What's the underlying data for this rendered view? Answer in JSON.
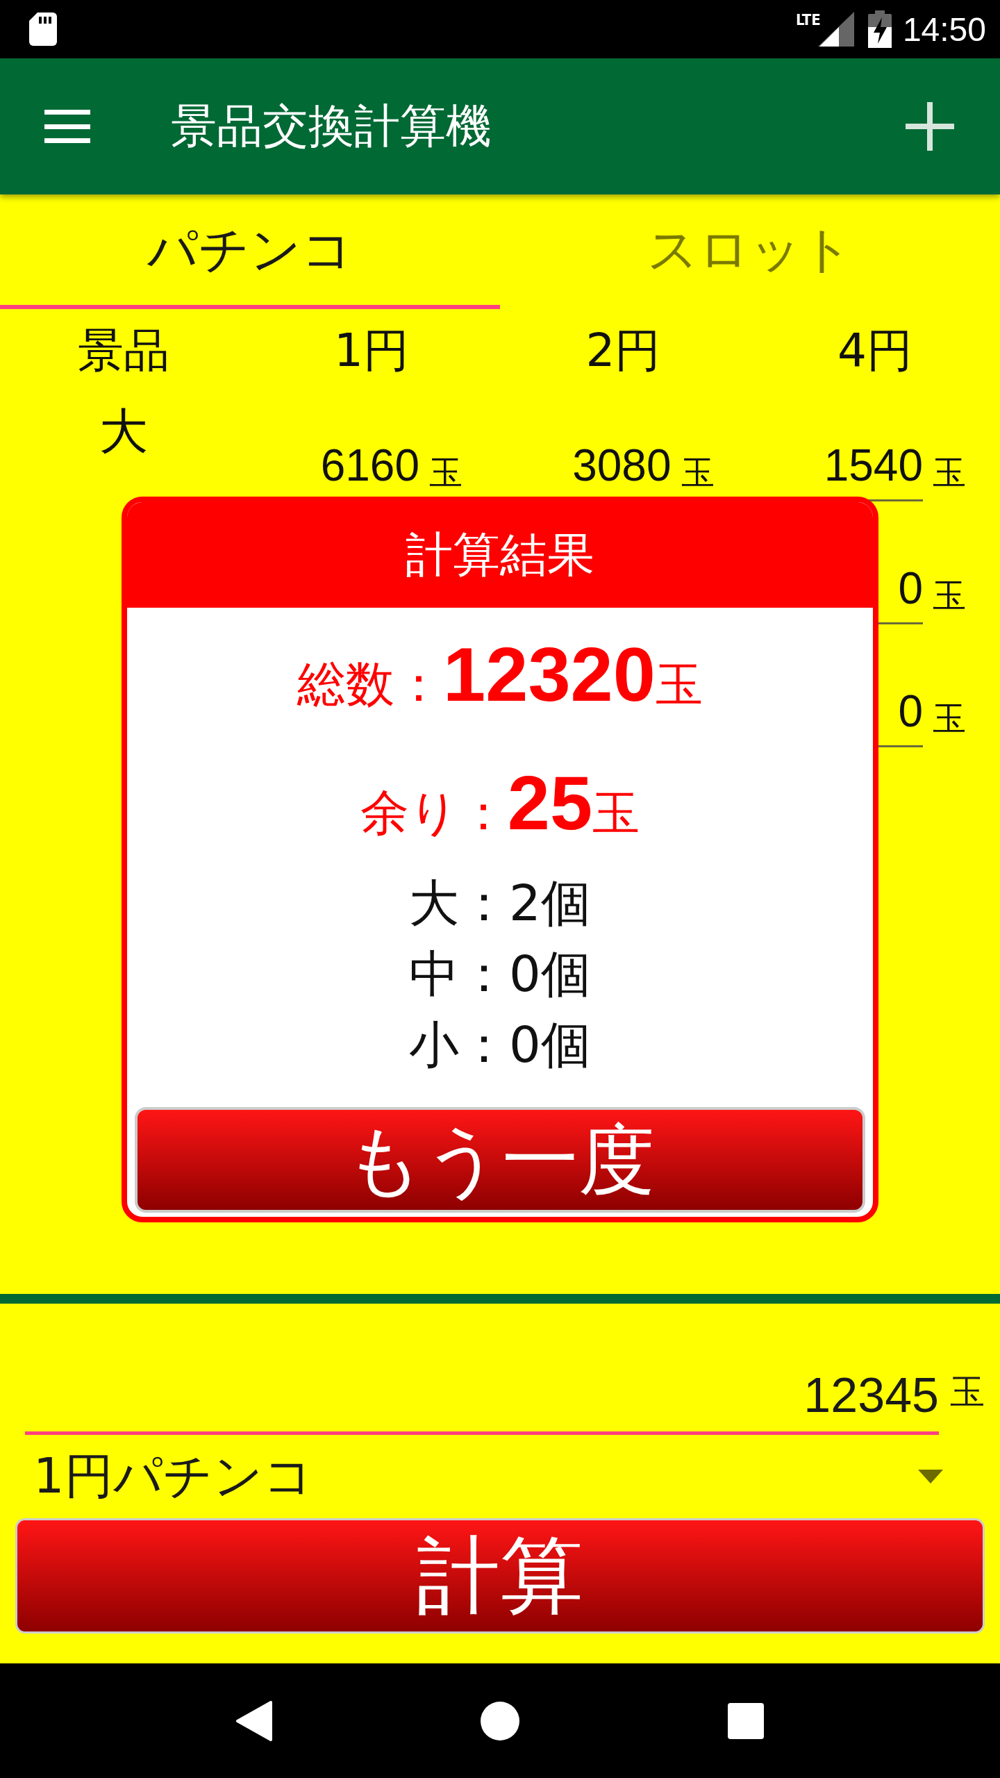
{
  "status_bar": {
    "network": "LTE",
    "time": "14:50"
  },
  "app_bar": {
    "title": "景品交換計算機"
  },
  "tabs": [
    {
      "label": "パチンコ",
      "selected": true
    },
    {
      "label": "スロット",
      "selected": false
    }
  ],
  "table": {
    "columns": [
      "景品",
      "1円",
      "2円",
      "4円"
    ],
    "rows": [
      {
        "cells": [
          "大",
          {
            "value": "6160",
            "unit": "玉"
          },
          {
            "value": "3080",
            "unit": "玉"
          },
          {
            "value": "1540",
            "unit": "玉"
          }
        ]
      },
      {
        "cells": [
          "",
          "",
          "",
          {
            "value": "0",
            "unit": "玉"
          }
        ]
      },
      {
        "cells": [
          "",
          "",
          "",
          {
            "value": "0",
            "unit": "玉"
          }
        ]
      }
    ]
  },
  "result_dialog": {
    "title": "計算結果",
    "total": {
      "label": "総数：",
      "value": "12320",
      "unit": "玉"
    },
    "remainder": {
      "label": "余り：",
      "value": "25",
      "unit": "玉"
    },
    "counts": [
      "大：2個",
      "中：0個",
      "小：0個"
    ],
    "button": "もう一度"
  },
  "balls_input": {
    "value": "12345",
    "unit": "玉"
  },
  "machine_select": {
    "value": "1円パチンコ"
  },
  "calculate_button": "計算"
}
